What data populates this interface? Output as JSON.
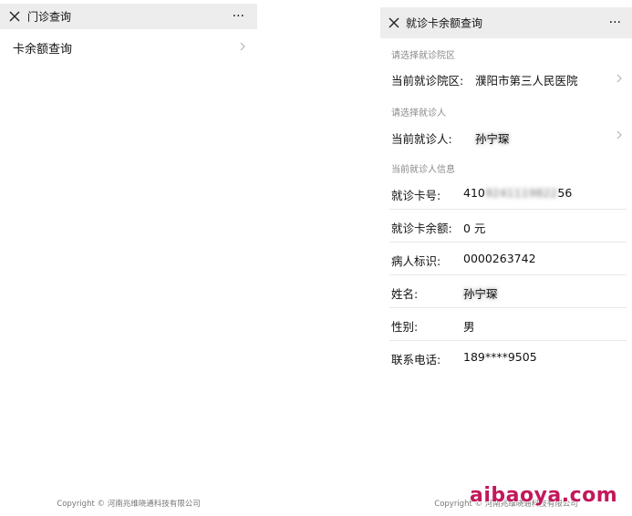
{
  "left_screen": {
    "title": "门诊查询",
    "more_label": "···",
    "menu_items": [
      {
        "label": "卡余额查询"
      }
    ],
    "copyright": "Copyright © 河南兆维晓通科技有限公司"
  },
  "right_screen": {
    "title": "就诊卡余额查询",
    "more_label": "···",
    "section_campus": {
      "header": "请选择就诊院区",
      "row_key": "当前就诊院区:",
      "row_value": "濮阳市第三人民医院"
    },
    "section_patient": {
      "header": "请选择就诊人",
      "row_key": "当前就诊人:",
      "row_value": "孙宁琛"
    },
    "section_info": {
      "header": "当前就诊人信息",
      "rows": [
        {
          "key": "就诊卡号:",
          "value_prefix": "410",
          "value_blurred": "9241119822",
          "value_suffix": "56"
        },
        {
          "key": "就诊卡余额:",
          "value": "0 元"
        },
        {
          "key": "病人标识:",
          "value": "0000263742"
        },
        {
          "key": "姓名:",
          "value": "孙宁琛"
        },
        {
          "key": "性别:",
          "value": "男"
        },
        {
          "key": "联系电话:",
          "value": "189****9505"
        }
      ]
    },
    "copyright": "Copyright © 河南兆维晓通科技有限公司"
  },
  "watermark": "aibaoya.com",
  "icons": {
    "close": "close-icon",
    "more": "more-icon",
    "chevron": "chevron-right-icon"
  },
  "colors": {
    "titlebar_bg": "#ededed",
    "section_header": "#8a8a8a",
    "divider": "#e8e8e8",
    "watermark": "#c2185b"
  }
}
